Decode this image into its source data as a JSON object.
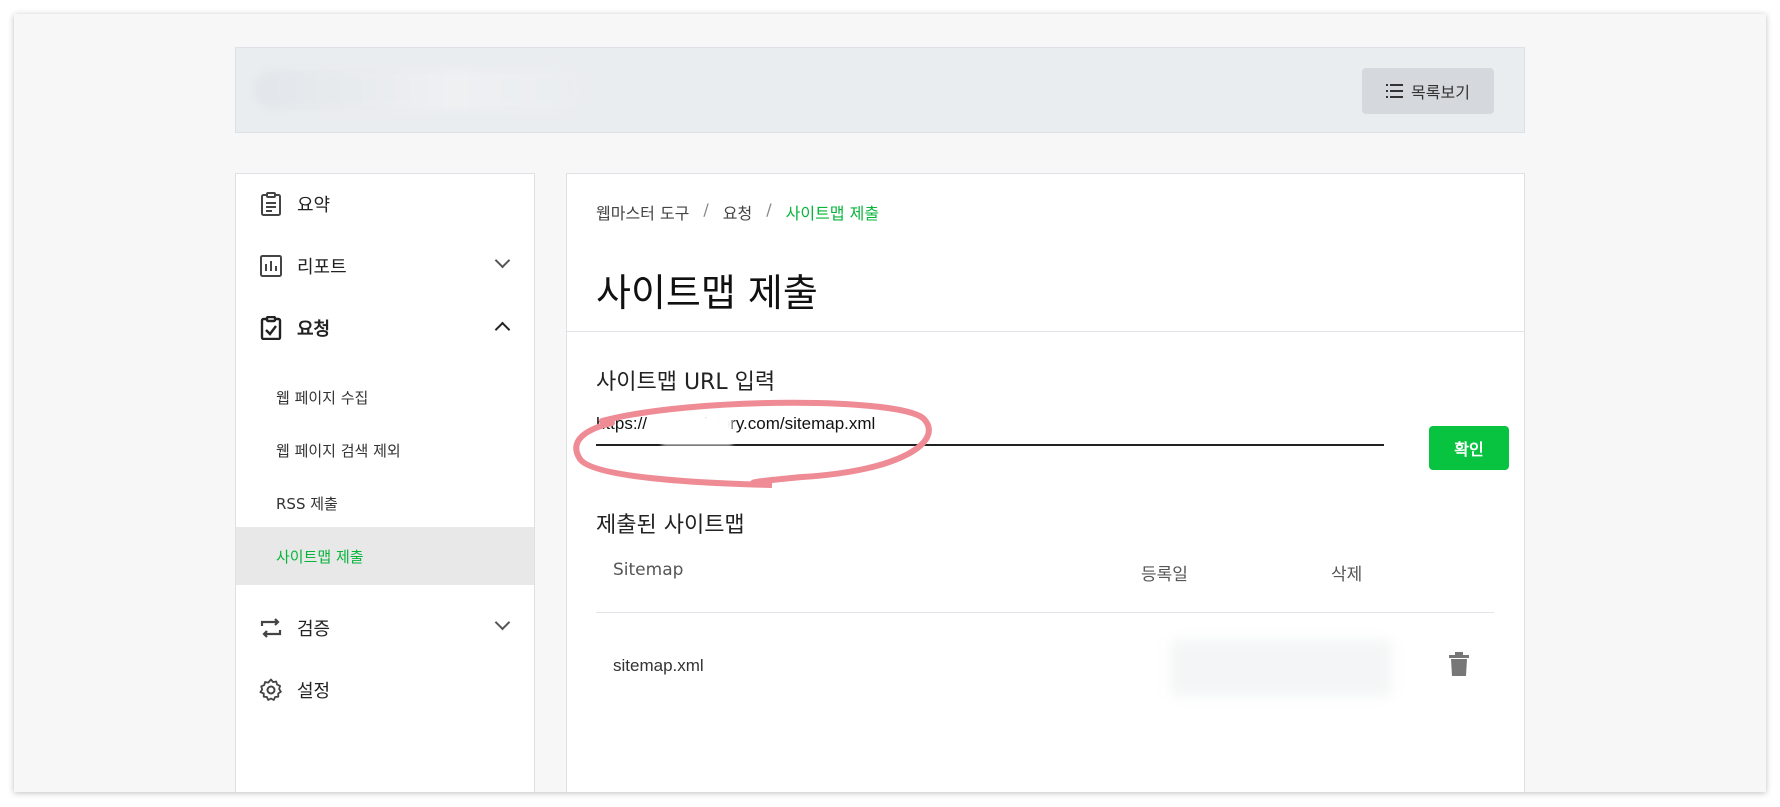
{
  "header": {
    "list_button_label": "목록보기"
  },
  "sidebar": {
    "items": [
      {
        "label": "요약"
      },
      {
        "label": "리포트"
      },
      {
        "label": "요청"
      },
      {
        "label": "검증"
      },
      {
        "label": "설정"
      }
    ],
    "sub_items": [
      {
        "label": "웹 페이지 수집"
      },
      {
        "label": "웹 페이지 검색 제외"
      },
      {
        "label": "RSS 제출"
      },
      {
        "label": "사이트맵 제출"
      }
    ]
  },
  "breadcrumb": {
    "items": [
      "웹마스터 도구",
      "요청",
      "사이트맵 제출"
    ],
    "separator": "/"
  },
  "main": {
    "title": "사이트맵 제출",
    "input_section_title": "사이트맵 URL 입력",
    "url_value": "https://          .tistory.com/sitemap.xml",
    "confirm_label": "확인",
    "submitted_title": "제출된 사이트맵",
    "table": {
      "headers": [
        "Sitemap",
        "등록일",
        "삭제"
      ],
      "rows": [
        {
          "sitemap": "sitemap.xml"
        }
      ]
    }
  },
  "colors": {
    "accent": "#07c33f",
    "annotation": "#ee8b95"
  }
}
